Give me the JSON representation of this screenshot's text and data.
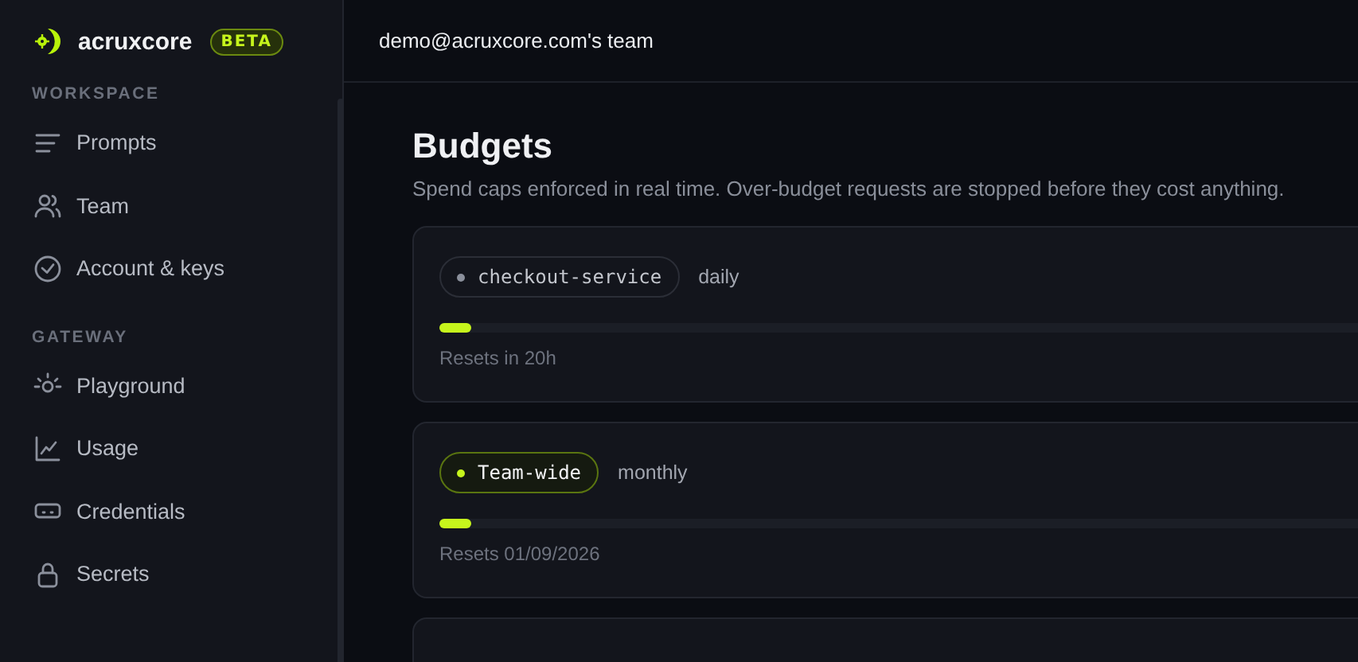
{
  "brand": {
    "name": "acruxcore",
    "badge": "BETA"
  },
  "sidebar": {
    "sections": [
      {
        "title": "WORKSPACE",
        "items": [
          {
            "label": "Prompts",
            "kind": "lines"
          },
          {
            "label": "Team",
            "kind": "users"
          },
          {
            "label": "Account & keys",
            "kind": "check"
          }
        ]
      },
      {
        "title": "GATEWAY",
        "items": [
          {
            "label": "Playground",
            "kind": "bulb"
          },
          {
            "label": "Usage",
            "kind": "chart"
          },
          {
            "label": "Credentials",
            "kind": "card"
          },
          {
            "label": "Secrets",
            "kind": "lock"
          }
        ]
      }
    ]
  },
  "header": {
    "team": "demo@acruxcore.com's team"
  },
  "page": {
    "title": "Budgets",
    "subtitle": "Spend caps enforced in real time. Over-budget requests are stopped before they cost anything."
  },
  "budgets": [
    {
      "scope": "checkout-service",
      "selected": false,
      "period": "daily",
      "level": 0.03,
      "reset": "Resets in 20h"
    },
    {
      "scope": "Team-wide",
      "selected": true,
      "period": "monthly",
      "level": 0.03,
      "reset": "Resets 01/09/2026"
    }
  ]
}
